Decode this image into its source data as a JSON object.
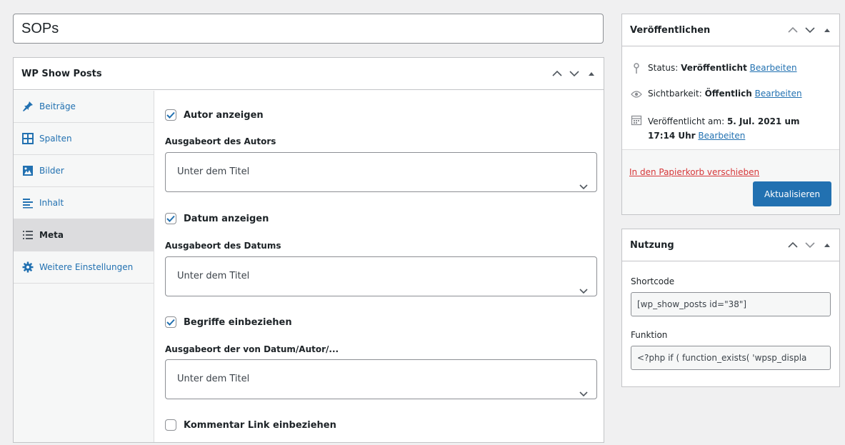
{
  "post_title": "SOPs",
  "wpsp_box": {
    "title": "WP Show Posts",
    "tabs": [
      {
        "label": "Beiträge",
        "icon": "pin-icon"
      },
      {
        "label": "Spalten",
        "icon": "columns-icon"
      },
      {
        "label": "Bilder",
        "icon": "image-icon"
      },
      {
        "label": "Inhalt",
        "icon": "text-align-icon"
      },
      {
        "label": "Meta",
        "icon": "list-icon",
        "active": true
      },
      {
        "label": "Weitere Einstellungen",
        "icon": "gear-icon"
      }
    ],
    "fields": {
      "author_checkbox": {
        "label": "Autor anzeigen",
        "checked": true
      },
      "author_location": {
        "label": "Ausgabeort des Autors",
        "value": "Unter dem Titel"
      },
      "date_checkbox": {
        "label": "Datum anzeigen",
        "checked": true
      },
      "date_location": {
        "label": "Ausgabeort des Datums",
        "value": "Unter dem Titel"
      },
      "terms_checkbox": {
        "label": "Begriffe einbeziehen",
        "checked": true
      },
      "terms_location": {
        "label": "Ausgabeort der von Datum/Autor/...",
        "value": "Unter dem Titel"
      },
      "comment_checkbox": {
        "label": "Kommentar Link einbeziehen",
        "checked": false
      }
    }
  },
  "publish_box": {
    "title": "Veröffentlichen",
    "status_label": "Status:",
    "status_value": "Veröffentlicht",
    "visibility_label": "Sichtbarkeit:",
    "visibility_value": "Öffentlich",
    "published_label": "Veröffentlicht am:",
    "published_value_line1": "5. Jul. 2021 um",
    "published_value_line2": "17:14 Uhr",
    "edit_link": "Bearbeiten",
    "trash_link": "In den Papierkorb verschieben",
    "update_button": "Aktualisieren"
  },
  "usage_box": {
    "title": "Nutzung",
    "shortcode_label": "Shortcode",
    "shortcode_value": "[wp_show_posts id=\"38\"]",
    "function_label": "Funktion",
    "function_value": "<?php if ( function_exists( 'wpsp_displa"
  },
  "colors": {
    "accent": "#2271b1",
    "danger": "#d63638",
    "background": "#f0f0f1"
  }
}
